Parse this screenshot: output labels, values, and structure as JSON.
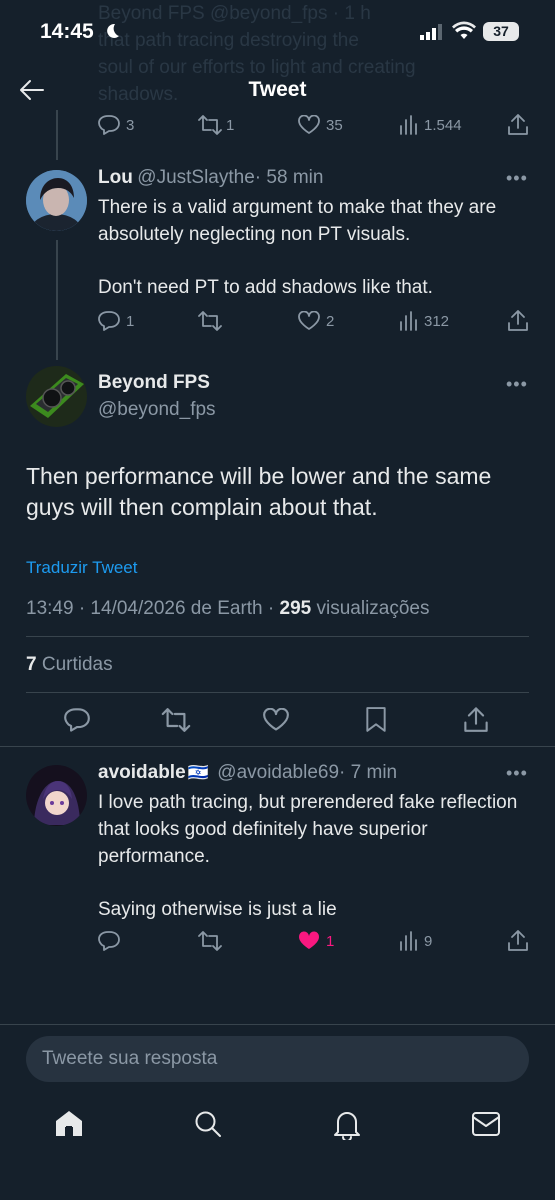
{
  "status_bar": {
    "time": "14:45",
    "battery": "37"
  },
  "previous_tweet": {
    "text_lines": [
      "Beyond FPS @beyond_fps · 1 h",
      "that path tracing destroying the",
      "soul of our efforts to light and creating",
      "shadows."
    ],
    "replies": "3",
    "retweets": "1",
    "likes": "35",
    "views": "1.544"
  },
  "header": {
    "title": "Tweet"
  },
  "reply_lou": {
    "name": "Lou",
    "handle": "@JustSlaythe",
    "time": "· 58 min",
    "body_1": "There is a valid argument to make that they are absolutely neglecting non PT visuals.",
    "body_2": "Don't need PT to add shadows like that.",
    "replies": "1",
    "likes": "2",
    "views": "312"
  },
  "main_tweet": {
    "name": "Beyond FPS",
    "handle": "@beyond_fps",
    "body": "Then performance will be lower and the same guys will then complain about that.",
    "translate": "Traduzir Tweet",
    "meta_time": "13:49 · 14/04/2026 de Earth · ",
    "views_count": "295",
    "views_label": " visualizações",
    "likes_count": "7",
    "likes_label": " Curtidas"
  },
  "reply_avoidable": {
    "name": "avoidable",
    "flag": "🇮🇱",
    "handle": "@avoidable69",
    "time": "· 7 min",
    "body_1": "I love path tracing, but prerendered fake reflection that looks good definitely have superior performance.",
    "body_2": "Saying otherwise is just a lie",
    "likes": "1",
    "views": "9"
  },
  "reply_input": {
    "placeholder": "Tweete sua resposta"
  },
  "colors": {
    "background": "#15202b",
    "accent": "#1d9bf0",
    "like": "#f91880",
    "muted": "#8b98a5"
  },
  "bottom_nav": [
    "home-icon",
    "search-icon",
    "notifications-icon",
    "messages-icon"
  ]
}
